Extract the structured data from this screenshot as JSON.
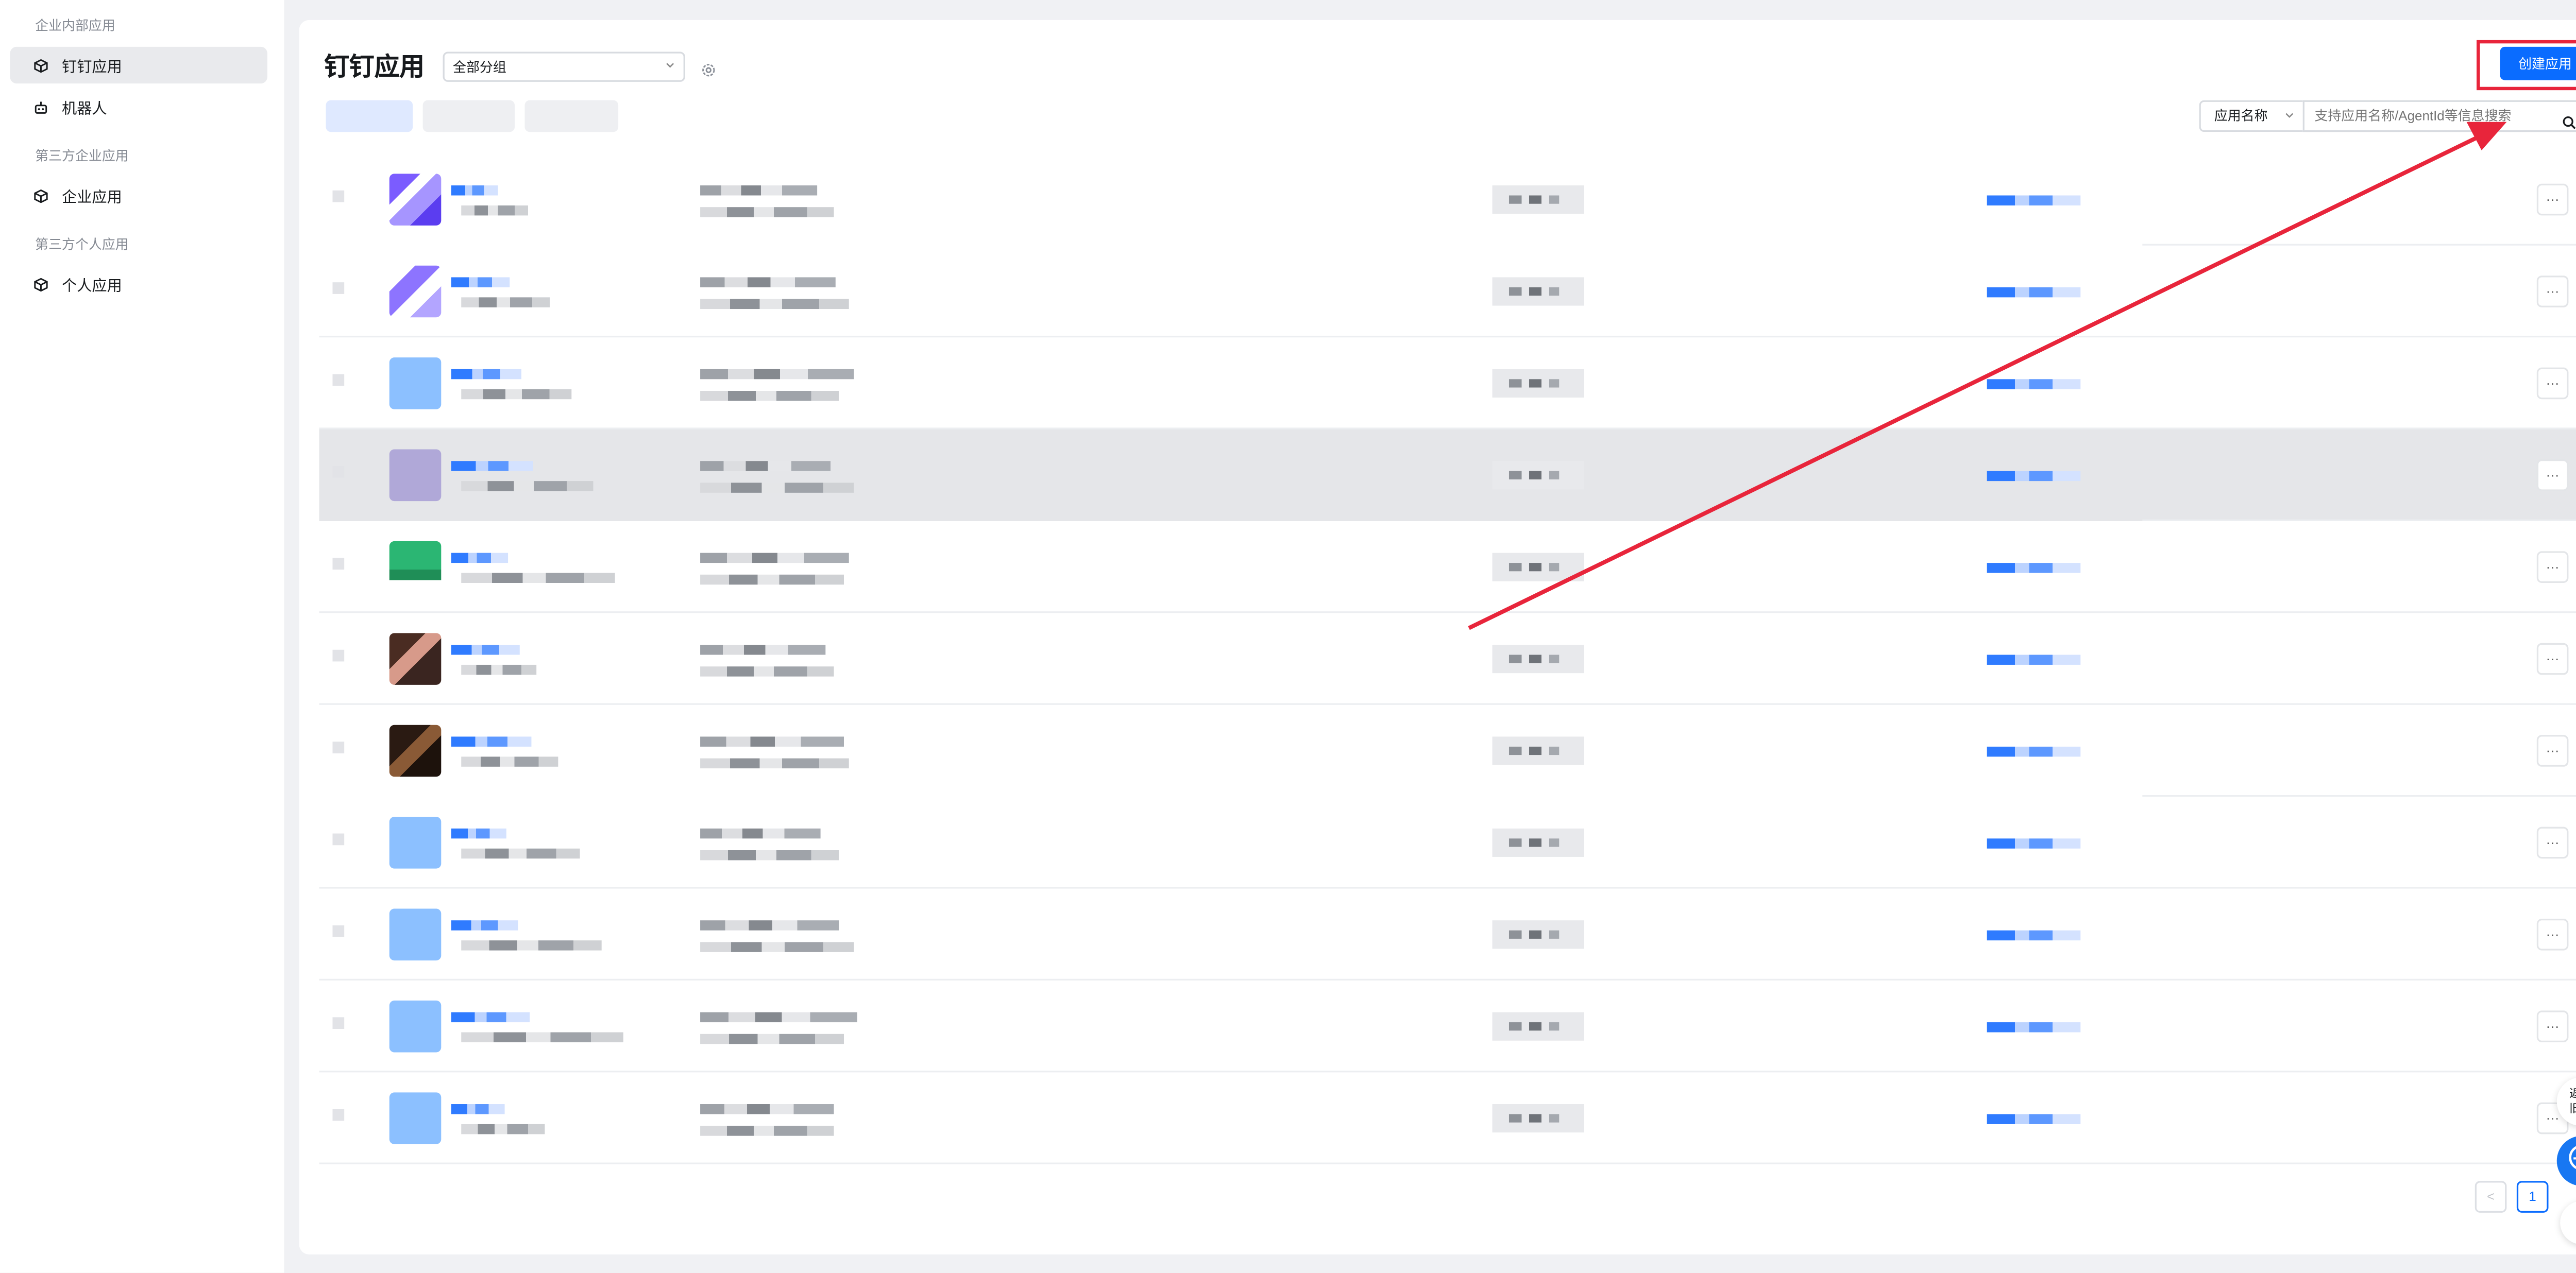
{
  "sidebar": {
    "groups": [
      {
        "title": "企业内部应用",
        "items": [
          {
            "label": "钉钉应用",
            "icon": "cube-icon",
            "active": true
          },
          {
            "label": "机器人",
            "icon": "robot-icon"
          }
        ]
      },
      {
        "title": "第三方企业应用",
        "items": [
          {
            "label": "企业应用",
            "icon": "cube-icon"
          }
        ]
      },
      {
        "title": "第三方个人应用",
        "items": [
          {
            "label": "个人应用",
            "icon": "cube-icon"
          }
        ]
      }
    ]
  },
  "header": {
    "title": "钉钉应用",
    "group_select": "全部分组",
    "create_button": "创建应用"
  },
  "search": {
    "field_select": "应用名称",
    "placeholder": "支持应用名称/AgentId等信息搜索"
  },
  "table": {
    "row_count": 11,
    "more_label": "···"
  },
  "pagination": {
    "prev": "<",
    "current": "1",
    "next": ">"
  },
  "floating": {
    "old_version": "返回\n旧版",
    "expand": "»"
  },
  "colors": {
    "primary": "#0a6cff",
    "annotation": "#e8253b",
    "hover_row": "#e5e6e9"
  }
}
